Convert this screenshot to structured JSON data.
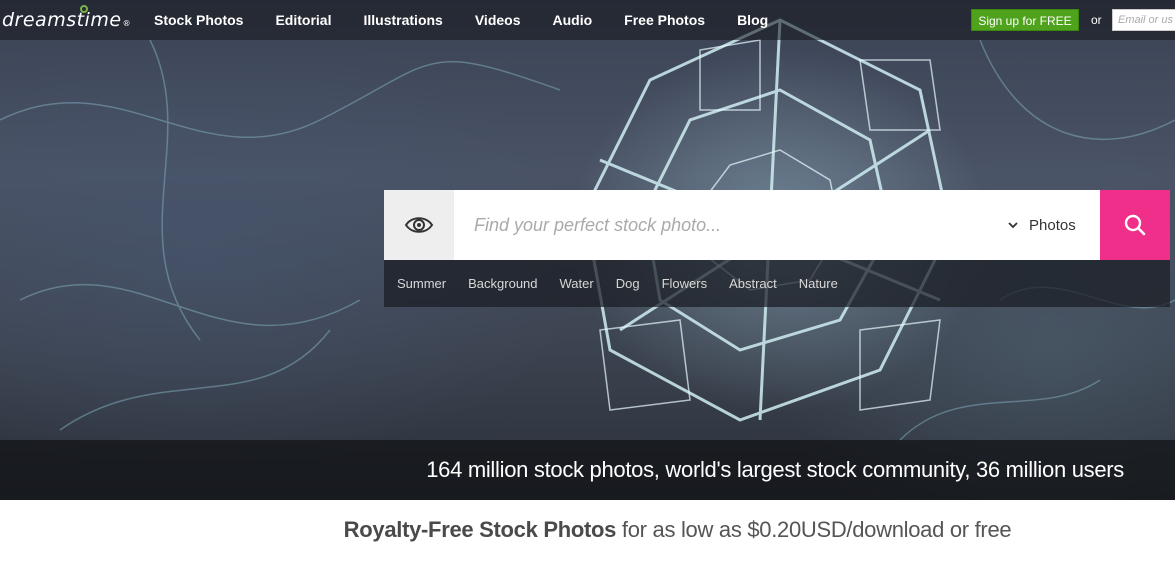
{
  "brand": {
    "logo_text": "dreamstime",
    "reg_mark": "®",
    "accent": "#7ab648"
  },
  "nav": {
    "items": [
      {
        "label": "Stock Photos"
      },
      {
        "label": "Editorial"
      },
      {
        "label": "Illustrations"
      },
      {
        "label": "Videos"
      },
      {
        "label": "Audio"
      },
      {
        "label": "Free Photos"
      },
      {
        "label": "Blog"
      }
    ]
  },
  "account": {
    "signup_label": "Sign up for FREE",
    "or_label": "or",
    "email_placeholder": "Email or us",
    "signup_color": "#4fa31c"
  },
  "search": {
    "eye_icon": "eye-icon",
    "placeholder": "Find your perfect stock photo...",
    "category": "Photos",
    "button_icon": "search-icon",
    "button_color": "#f02f8a"
  },
  "tags": [
    "Summer",
    "Background",
    "Water",
    "Dog",
    "Flowers",
    "Abstract",
    "Nature"
  ],
  "stats": {
    "text": "164 million stock photos, world's largest stock community, 36 million users"
  },
  "tagline": {
    "bold": "Royalty-Free Stock Photos",
    "rest": "for as low as $0.20USD/download or free"
  }
}
